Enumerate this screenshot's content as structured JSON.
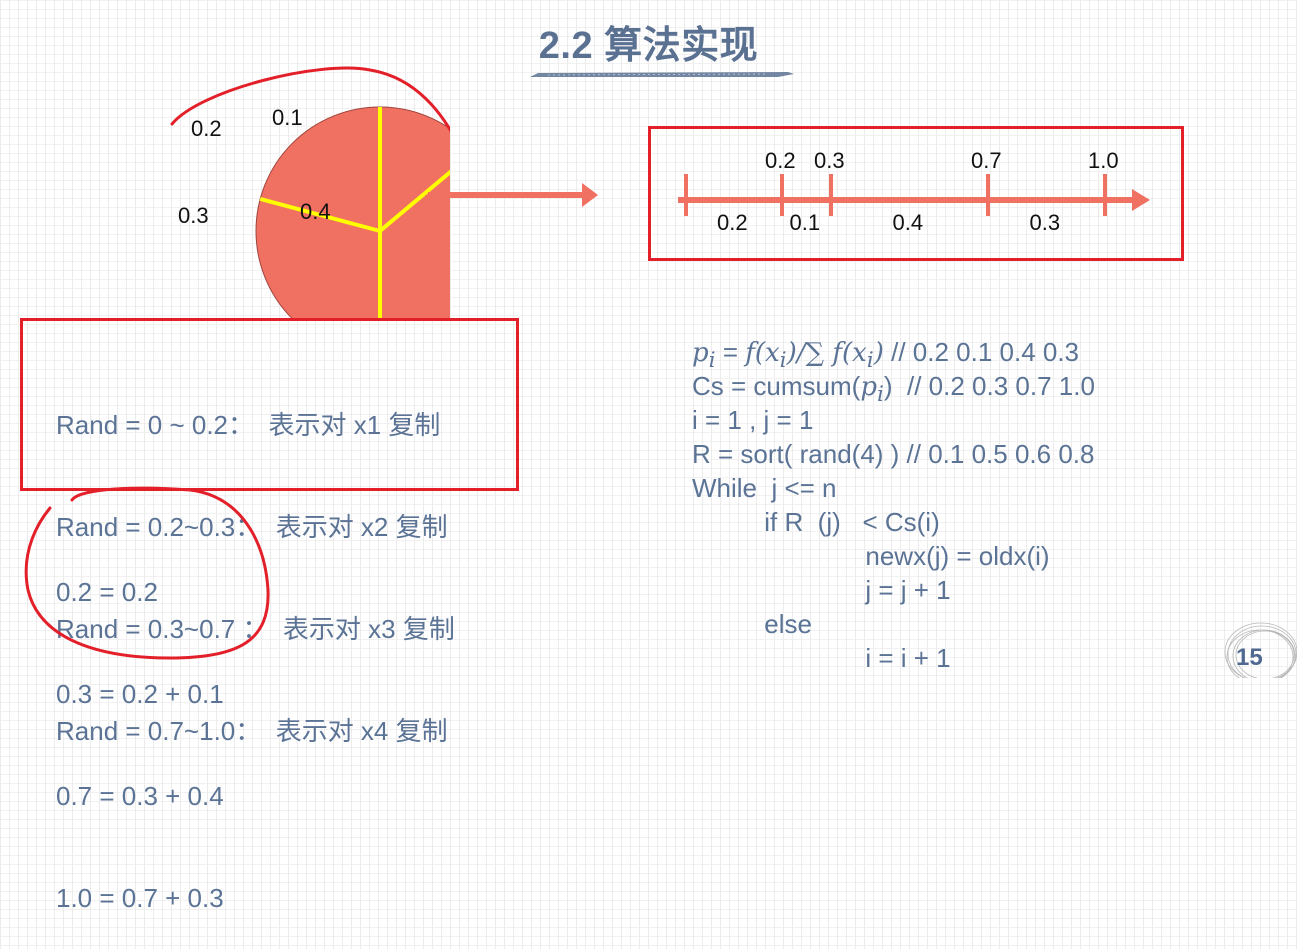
{
  "slide": {
    "title": "2.2 算法实现",
    "page_number": "15"
  },
  "colors": {
    "title": "#5a7192",
    "body_text": "#5b7395",
    "pie_fill": "#f07062",
    "divider": "#ffff00",
    "arrow": "#f07062",
    "annotation_red": "#e3202a"
  },
  "pie": {
    "slices": [
      {
        "label": "0.1",
        "value": 0.1
      },
      {
        "label": "0.4",
        "value": 0.4
      },
      {
        "label": "0.3",
        "value": 0.3
      },
      {
        "label": "0.2",
        "value": 0.2
      }
    ]
  },
  "number_line": {
    "cumulative_labels": [
      "0.2",
      "0.3",
      "0.7",
      "1.0"
    ],
    "cumulative_values": [
      0.2,
      0.3,
      0.7,
      1.0
    ],
    "segment_labels": [
      "0.2",
      "0.1",
      "0.4",
      "0.3"
    ]
  },
  "rand_rules": [
    "Rand = 0 ~ 0.2：  表示对 x1 复制",
    "Rand = 0.2~0.3：  表示对 x2 复制",
    "Rand = 0.3~0.7 ：  表示对 x3 复制",
    "Rand = 0.7~1.0：  表示对 x4 复制"
  ],
  "cumsum_equations": [
    "0.2 = 0.2",
    "0.3 = 0.2 + 0.1",
    "0.7 = 0.3 + 0.4",
    "1.0 = 0.7 + 0.3"
  ],
  "algorithm": {
    "line1_math_p": "p",
    "line1_math_sub": "i",
    "line1_eq": " = ",
    "line1_f1": "f(x",
    "line1_sub2": "i",
    "line1_close": ")/∑ f(x",
    "line1_sub3": "i",
    "line1_close2": ")",
    "line1_comment": " // 0.2 0.1 0.4 0.3",
    "line2_prefix": "Cs = cumsum(",
    "line2_math_p": "p",
    "line2_math_sub": "i",
    "line2_suffix": ")  // 0.2 0.3 0.7 1.0",
    "lines": [
      "i = 1 , j = 1",
      "R = sort( rand(4) ) // 0.1 0.5 0.6 0.8",
      "While  j <= n",
      "          if R  (j)   < Cs(i)",
      "                        newx(j) = oldx(i)",
      "                        j = j + 1",
      "          else",
      "                        i = i + 1"
    ]
  }
}
